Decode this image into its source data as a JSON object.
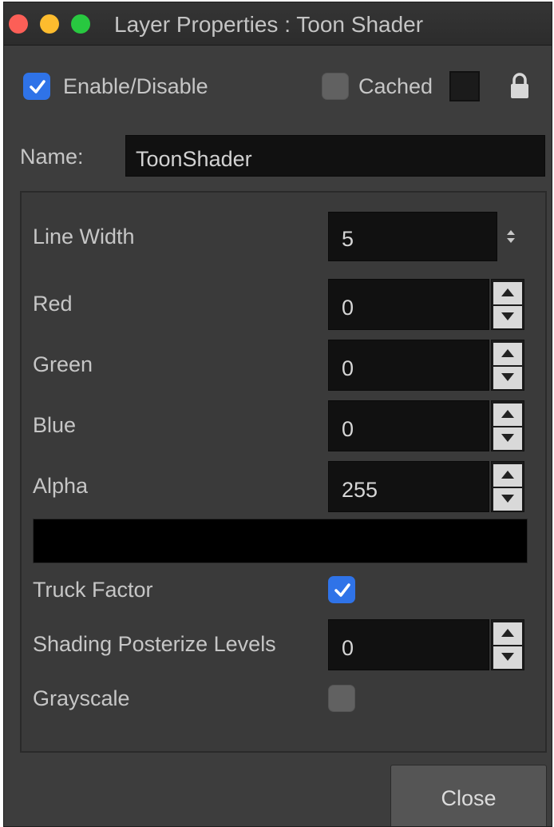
{
  "window": {
    "title": "Layer Properties : Toon Shader"
  },
  "header": {
    "enable_label": "Enable/Disable",
    "enable_checked": true,
    "cached_label": "Cached",
    "cached_checked": false,
    "cached_color": "#1b1b1b"
  },
  "name": {
    "label": "Name:",
    "value": "ToonShader"
  },
  "params": {
    "line_width": {
      "label": "Line Width",
      "value": "5"
    },
    "red": {
      "label": "Red",
      "value": "0"
    },
    "green": {
      "label": "Green",
      "value": "0"
    },
    "blue": {
      "label": "Blue",
      "value": "0"
    },
    "alpha": {
      "label": "Alpha",
      "value": "255"
    },
    "color_preview": "#000000",
    "truck_factor": {
      "label": "Truck Factor",
      "checked": true
    },
    "shading_posterize": {
      "label": "Shading Posterize Levels",
      "value": "0"
    },
    "grayscale": {
      "label": "Grayscale",
      "checked": false
    }
  },
  "footer": {
    "close_label": "Close"
  }
}
